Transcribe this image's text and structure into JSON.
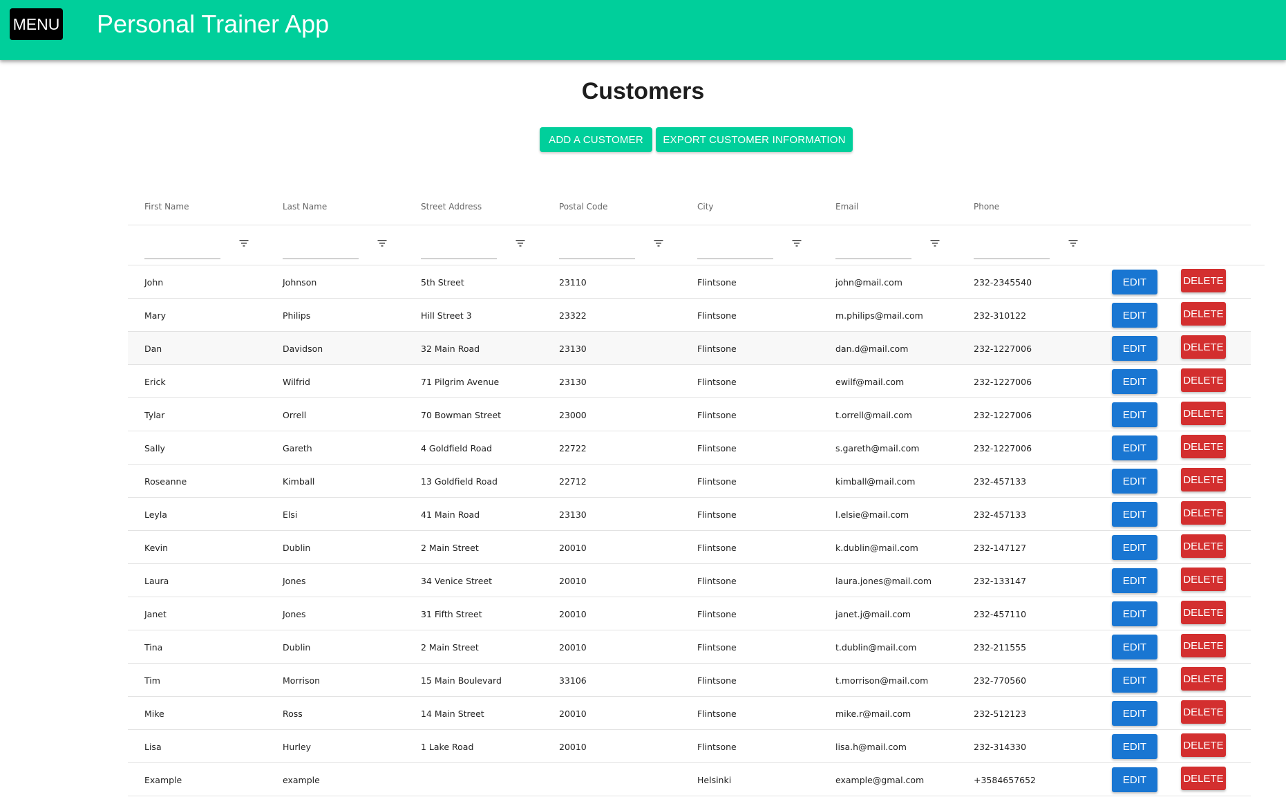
{
  "appbar": {
    "menu_label": "MENU",
    "title": "Personal Trainer App",
    "color": "#00cf9b"
  },
  "page": {
    "title": "Customers"
  },
  "actions": {
    "add_label": "ADD A CUSTOMER",
    "export_label": "EXPORT CUSTOMER INFORMATION"
  },
  "table": {
    "columns": [
      "First Name",
      "Last Name",
      "Street Address",
      "Postal Code",
      "City",
      "Email",
      "Phone"
    ],
    "edit_label": "EDIT",
    "delete_label": "DELETE",
    "filter_icon": "filter-icon",
    "rows": [
      [
        "John",
        "Johnson",
        "5th Street",
        "23110",
        "Flintsone",
        "john@mail.com",
        "232-2345540"
      ],
      [
        "Mary",
        "Philips",
        "Hill Street 3",
        "23322",
        "Flintsone",
        "m.philips@mail.com",
        "232-310122"
      ],
      [
        "Dan",
        "Davidson",
        "32 Main Road",
        "23130",
        "Flintsone",
        "dan.d@mail.com",
        "232-1227006"
      ],
      [
        "Erick",
        "Wilfrid",
        "71 Pilgrim Avenue",
        "23130",
        "Flintsone",
        "ewilf@mail.com",
        "232-1227006"
      ],
      [
        "Tylar",
        "Orrell",
        "70 Bowman Street",
        "23000",
        "Flintsone",
        "t.orrell@mail.com",
        "232-1227006"
      ],
      [
        "Sally",
        "Gareth",
        "4 Goldfield Road",
        "22722",
        "Flintsone",
        "s.gareth@mail.com",
        "232-1227006"
      ],
      [
        "Roseanne",
        "Kimball",
        "13 Goldfield Road",
        "22712",
        "Flintsone",
        "kimball@mail.com",
        "232-457133"
      ],
      [
        "Leyla",
        "Elsi",
        "41 Main Road",
        "23130",
        "Flintsone",
        "l.elsie@mail.com",
        "232-457133"
      ],
      [
        "Kevin",
        "Dublin",
        "2 Main Street",
        "20010",
        "Flintsone",
        "k.dublin@mail.com",
        "232-147127"
      ],
      [
        "Laura",
        "Jones",
        "34 Venice Street",
        "20010",
        "Flintsone",
        "laura.jones@mail.com",
        "232-133147"
      ],
      [
        "Janet",
        "Jones",
        "31 Fifth Street",
        "20010",
        "Flintsone",
        "janet.j@mail.com",
        "232-457110"
      ],
      [
        "Tina",
        "Dublin",
        "2 Main Street",
        "20010",
        "Flintsone",
        "t.dublin@mail.com",
        "232-211555"
      ],
      [
        "Tim",
        "Morrison",
        "15 Main Boulevard",
        "33106",
        "Flintsone",
        "t.morrison@mail.com",
        "232-770560"
      ],
      [
        "Mike",
        "Ross",
        "14 Main Street",
        "20010",
        "Flintsone",
        "mike.r@mail.com",
        "232-512123"
      ],
      [
        "Lisa",
        "Hurley",
        "1 Lake Road",
        "20010",
        "Flintsone",
        "lisa.h@mail.com",
        "232-314330"
      ],
      [
        "Example",
        "example",
        "",
        "",
        "Helsinki",
        "example@gmal.com",
        "+3584657652"
      ]
    ],
    "highlighted_row": 2
  },
  "colors": {
    "accent": "#00cf9b",
    "edit": "#1976d2",
    "delete": "#d32f2f",
    "menu": "#000000"
  }
}
